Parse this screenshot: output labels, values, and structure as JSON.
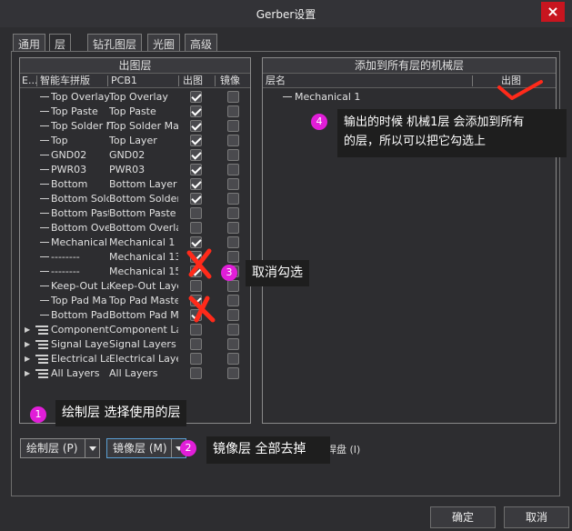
{
  "window": {
    "title": "Gerber设置",
    "close_label": "×"
  },
  "tabs": [
    {
      "label": "通用"
    },
    {
      "label": "层"
    },
    {
      "label": "钻孔图层"
    },
    {
      "label": "光圈"
    },
    {
      "label": "高级"
    }
  ],
  "left_panel": {
    "title": "出图层",
    "columns": [
      "E...",
      "智能车拼版",
      "PCB1",
      "出图",
      "镜像"
    ],
    "rows": [
      {
        "name": "Top Overlay",
        "layer": "Top Overlay",
        "plot": true,
        "mirror": false
      },
      {
        "name": "Top Paste",
        "layer": "Top Paste",
        "plot": true,
        "mirror": false
      },
      {
        "name": "Top Solder M",
        "layer": "Top Solder Ma",
        "plot": true,
        "mirror": false
      },
      {
        "name": "Top",
        "layer": "Top Layer",
        "plot": true,
        "mirror": false
      },
      {
        "name": "GND02",
        "layer": "GND02",
        "plot": true,
        "mirror": false
      },
      {
        "name": "PWR03",
        "layer": "PWR03",
        "plot": true,
        "mirror": false
      },
      {
        "name": "Bottom",
        "layer": "Bottom Layer",
        "plot": true,
        "mirror": false
      },
      {
        "name": "Bottom Sold",
        "layer": "Bottom Solder",
        "plot": true,
        "mirror": false
      },
      {
        "name": "Bottom Past",
        "layer": "Bottom Paste",
        "plot": false,
        "mirror": false
      },
      {
        "name": "Bottom Over",
        "layer": "Bottom Overla",
        "plot": false,
        "mirror": false
      },
      {
        "name": "Mechanical",
        "layer": "Mechanical 1",
        "plot": true,
        "mirror": false
      },
      {
        "name": "--------",
        "layer": "Mechanical 13",
        "plot": true,
        "mirror": false
      },
      {
        "name": "--------",
        "layer": "Mechanical 15",
        "plot": true,
        "mirror": false
      },
      {
        "name": "Keep-Out La",
        "layer": "Keep-Out Laye",
        "plot": false,
        "mirror": false
      },
      {
        "name": "Top Pad Ma",
        "layer": "Top Pad Maste",
        "plot": true,
        "mirror": false
      },
      {
        "name": "Bottom Pad",
        "layer": "Bottom Pad Ma",
        "plot": true,
        "mirror": false
      }
    ],
    "groups": [
      {
        "name": "Component",
        "layer": "Component La"
      },
      {
        "name": "Signal Layer",
        "layer": "Signal Layers"
      },
      {
        "name": "Electrical Lay",
        "layer": "Electrical Layer"
      },
      {
        "name": "All Layers",
        "layer": "All Layers"
      }
    ]
  },
  "right_panel": {
    "title": "添加到所有层的机械层",
    "columns": [
      "层名",
      "出图"
    ],
    "rows": [
      {
        "name": "Mechanical 1"
      }
    ]
  },
  "buttons": {
    "plot_layers": "绘制层 (P)",
    "mirror_layers": "镜像层 (M)",
    "pad_suffix": "同层焊盘 (I)",
    "ok": "确定",
    "cancel": "取消"
  },
  "annotations": [
    {
      "num": "1",
      "text": "绘制层 选择使用的层"
    },
    {
      "num": "2",
      "text": "镜像层 全部去掉"
    },
    {
      "num": "3",
      "text": "取消勾选"
    },
    {
      "num": "4",
      "line1": "输出的时候 机械1层 会添加到所有",
      "line2": "的层，所以可以把它勾选上"
    }
  ],
  "colors": {
    "annotation_badge": "#e11ed8",
    "mark": "#ff2a1a",
    "close": "#c8151f"
  }
}
